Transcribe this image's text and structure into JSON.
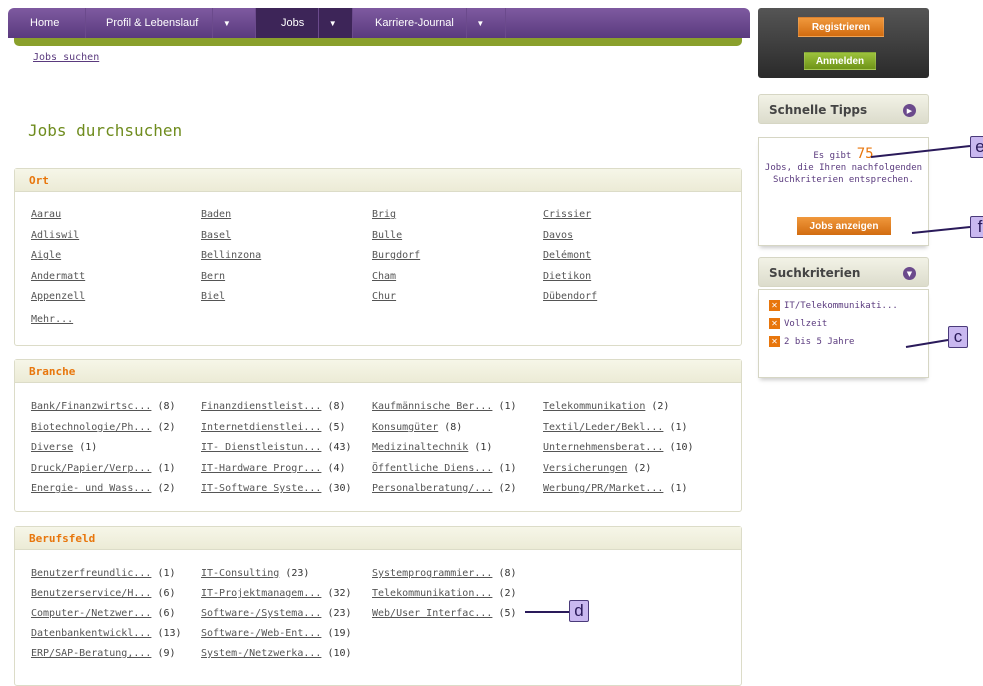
{
  "nav": {
    "items": [
      {
        "label": "Home",
        "caret": false
      },
      {
        "label": "Profil & Lebenslauf",
        "caret": true
      },
      {
        "label": "Jobs",
        "caret": true,
        "active": true
      },
      {
        "label": "Karriere-Journal",
        "caret": true
      }
    ]
  },
  "breadcrumb": "Jobs suchen",
  "title": "Jobs durchsuchen",
  "ort": {
    "heading": "Ort",
    "cols": [
      [
        "Aarau",
        "Adliswil",
        "Aigle",
        "Andermatt",
        "Appenzell"
      ],
      [
        "Baden",
        "Basel",
        "Bellinzona",
        "Bern",
        "Biel"
      ],
      [
        "Brig",
        "Bulle",
        "Burgdorf",
        "Cham",
        "Chur"
      ],
      [
        "Crissier",
        "Davos",
        "Delémont",
        "Dietikon",
        "Dübendorf"
      ]
    ],
    "more": "Mehr..."
  },
  "branche": {
    "heading": "Branche",
    "cols": [
      [
        [
          "Bank/Finanzwirtsc...",
          "(8)"
        ],
        [
          "Biotechnologie/Ph...",
          "(2)"
        ],
        [
          "Diverse",
          "(1)"
        ],
        [
          "Druck/Papier/Verp...",
          "(1)"
        ],
        [
          "Energie- und Wass...",
          "(2)"
        ]
      ],
      [
        [
          "Finanzdienstleist...",
          "(8)"
        ],
        [
          "Internetdienstlei...",
          "(5)"
        ],
        [
          "IT- Dienstleistun...",
          "(43)"
        ],
        [
          "IT-Hardware Progr...",
          "(4)"
        ],
        [
          "IT-Software Syste...",
          "(30)"
        ]
      ],
      [
        [
          "Kaufmännische Ber...",
          "(1)"
        ],
        [
          "Konsumgüter",
          "(8)"
        ],
        [
          "Medizinaltechnik",
          "(1)"
        ],
        [
          "Öffentliche Diens...",
          "(1)"
        ],
        [
          "Personalberatung/...",
          "(2)"
        ]
      ],
      [
        [
          "Telekommunikation",
          "(2)"
        ],
        [
          "Textil/Leder/Bekl...",
          "(1)"
        ],
        [
          "Unternehmensberat...",
          "(10)"
        ],
        [
          "Versicherungen",
          "(2)"
        ],
        [
          "Werbung/PR/Market...",
          "(1)"
        ]
      ]
    ]
  },
  "berufsfeld": {
    "heading": "Berufsfeld",
    "cols": [
      [
        [
          "Benutzerfreundlic...",
          "(1)"
        ],
        [
          "Benutzerservice/H...",
          "(6)"
        ],
        [
          "Computer-/Netzwer...",
          "(6)"
        ],
        [
          "Datenbankentwickl...",
          "(13)"
        ],
        [
          "ERP/SAP-Beratung,...",
          "(9)"
        ]
      ],
      [
        [
          "IT-Consulting",
          "(23)"
        ],
        [
          "IT-Projektmanagem...",
          "(32)"
        ],
        [
          "Software-/Systema...",
          "(23)"
        ],
        [
          "Software-/Web-Ent...",
          "(19)"
        ],
        [
          "System-/Netzwerka...",
          "(10)"
        ]
      ],
      [
        [
          "Systemprogrammier...",
          "(8)"
        ],
        [
          "Telekommunikation...",
          "(2)"
        ],
        [
          "Web/User Interfac...",
          "(5)"
        ]
      ]
    ]
  },
  "auth": {
    "register": "Registrieren",
    "login": "Anmelden"
  },
  "tips": {
    "heading": "Schnelle Tipps",
    "prefix": "Es gibt",
    "count": "75",
    "suffix": "Jobs, die Ihren nachfolgenden Suchkriterien entsprechen.",
    "button": "Jobs anzeigen"
  },
  "criteria": {
    "heading": "Suchkriterien",
    "items": [
      "IT/Telekommunikati...",
      "Vollzeit",
      "2 bis 5 Jahre"
    ]
  },
  "callouts": [
    "e",
    "f",
    "c",
    "d"
  ]
}
